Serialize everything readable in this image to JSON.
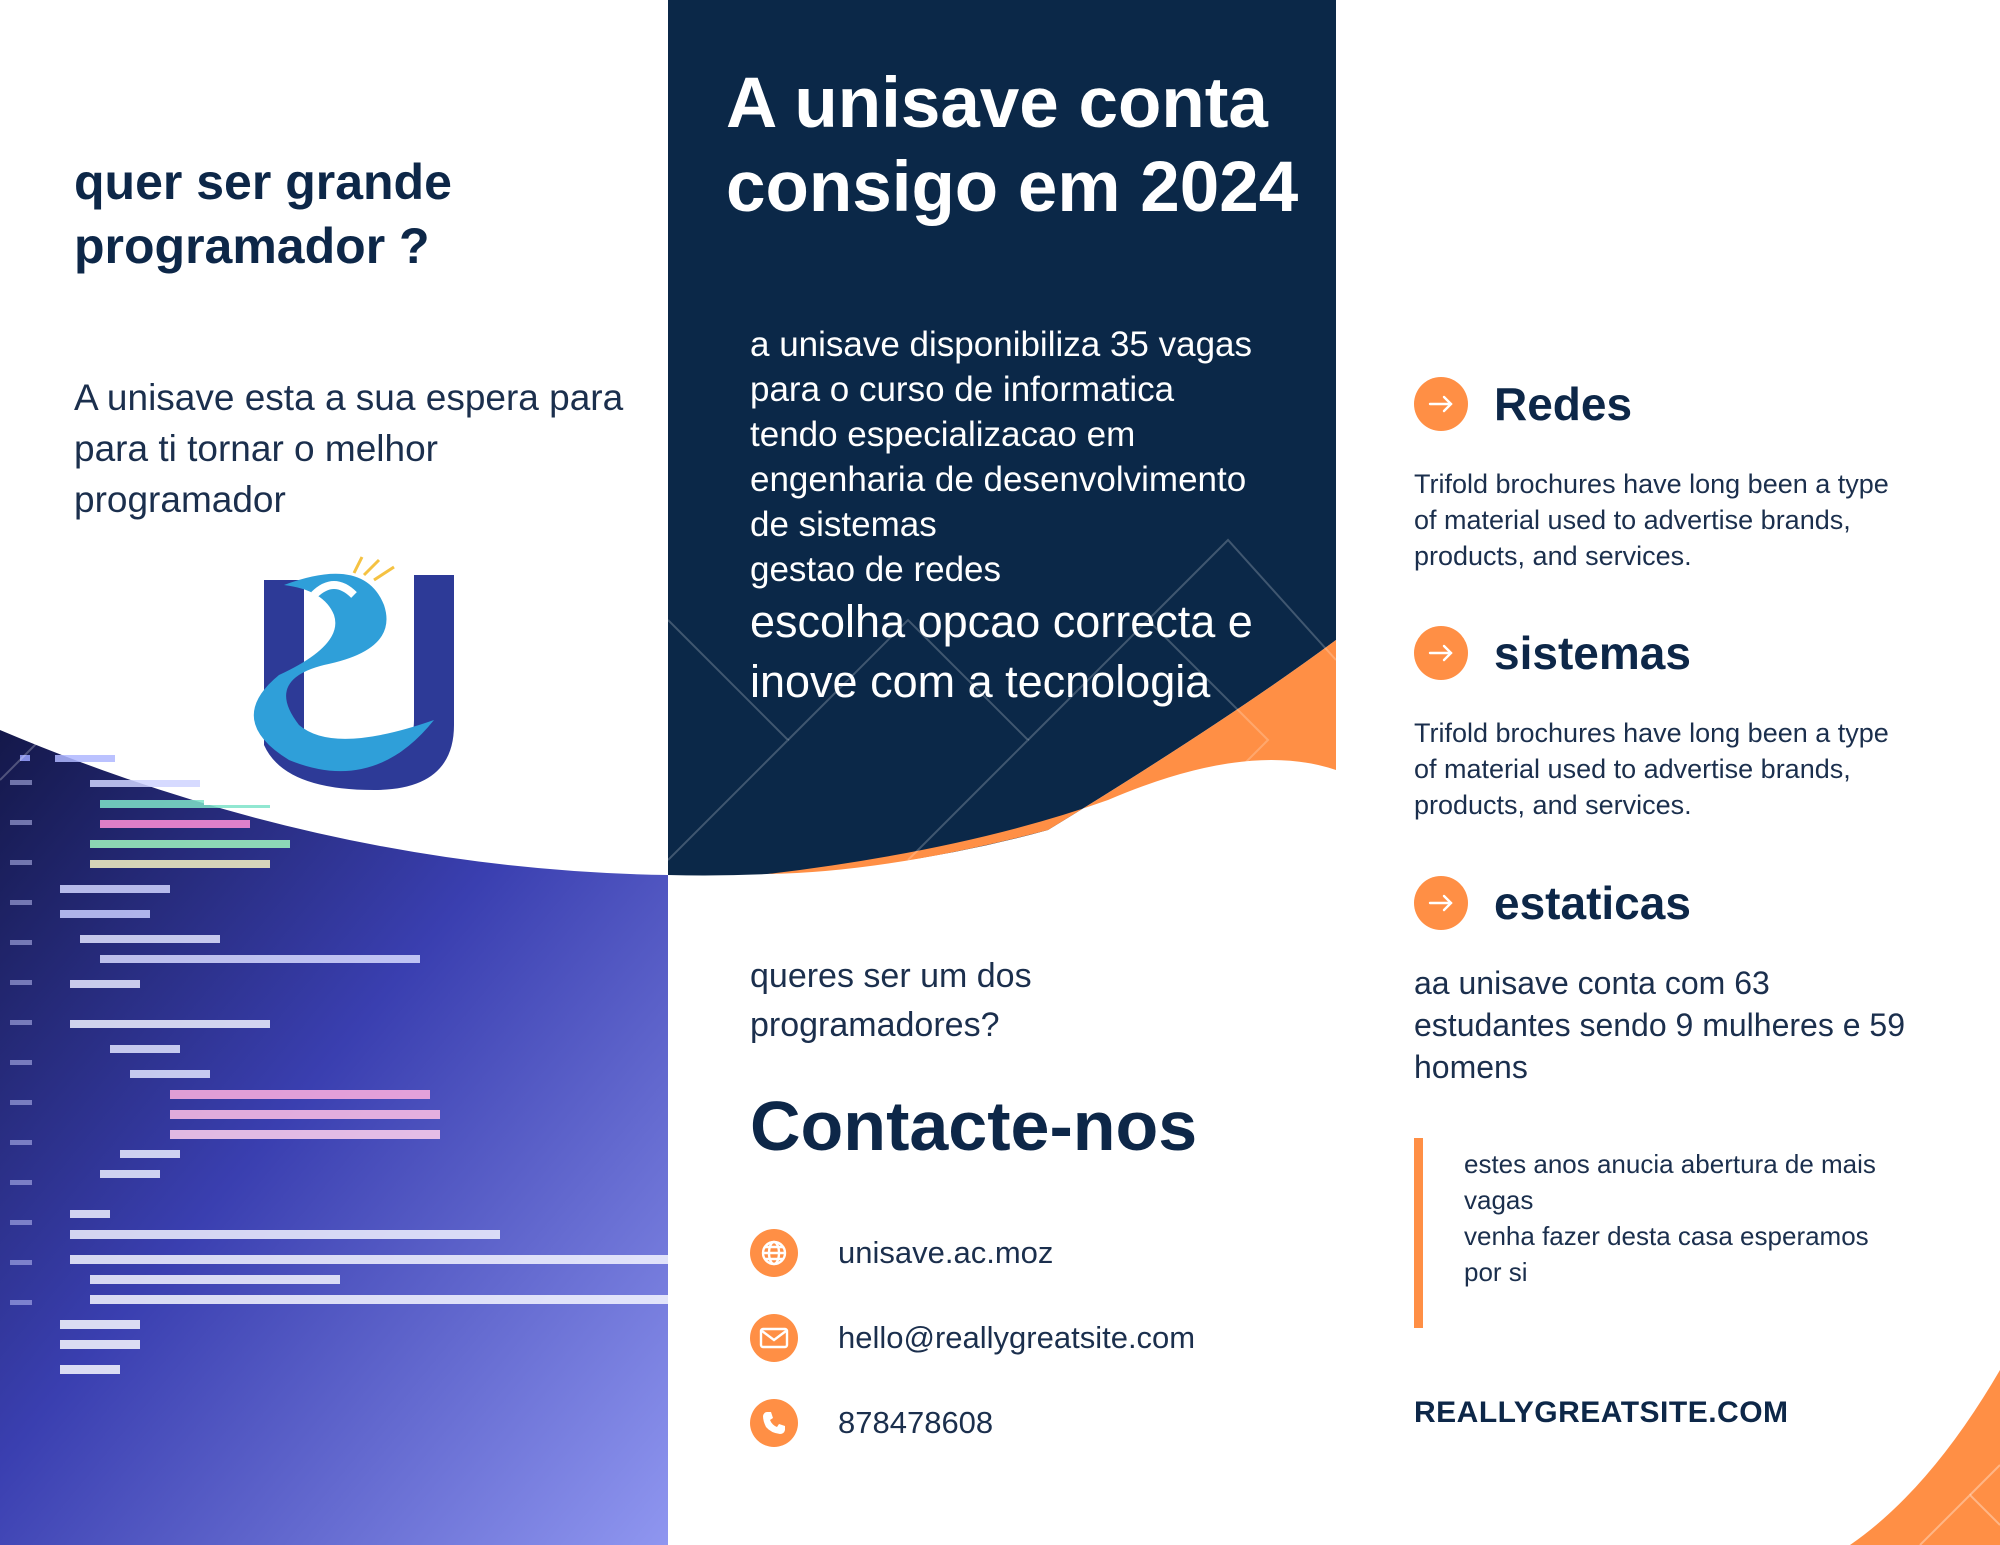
{
  "left_panel": {
    "headline": "quer ser grande programador ?",
    "body": "A unisave  esta a sua espera para para ti tornar o melhor programador",
    "logo_icon": "unisave-logo-icon",
    "photo_icon": "code-screen-photo"
  },
  "middle_panel": {
    "headline": "A unisave conta consigo em 2024",
    "body_lines": [
      "a unisave disponibiliza 35 vagas",
      "para o curso de informatica",
      "tendo especializacao em",
      "engenharia de desenvolvimento",
      "de sistemas",
      "gestao de redes"
    ],
    "highlight_lines": [
      "escolha opcao correcta e",
      "inove com a tecnologia"
    ],
    "question_lines": [
      "queres ser um  dos",
      "programadores?"
    ],
    "contact_title": "Contacte-nos",
    "contacts": {
      "website": {
        "icon": "globe-icon",
        "text": "unisave.ac.moz"
      },
      "email": {
        "icon": "mail-icon",
        "text": "hello@reallygreatsite.com"
      },
      "phone": {
        "icon": "phone-icon",
        "text": "878478608"
      }
    }
  },
  "right_panel": {
    "features": [
      {
        "title": "Redes",
        "icon": "arrow-right-icon",
        "text_lines": [
          "Trifold brochures have long been a type",
          "of material used to advertise brands,",
          "products, and services."
        ]
      },
      {
        "title": "sistemas",
        "icon": "arrow-right-icon",
        "text_lines": [
          "Trifold brochures have long been a type",
          "of material used to advertise brands,",
          "products, and services."
        ]
      },
      {
        "title": "estaticas",
        "icon": "arrow-right-icon",
        "text_lines": [
          "aa unisave conta com 63",
          "estudantes  sendo 9 mulheres e 59",
          "homens"
        ]
      }
    ],
    "quote_lines": [
      "estes anos anucia abertura de mais",
      "vagas",
      "venha fazer desta casa esperamos",
      "por si"
    ],
    "site_url": "REALLYGREATSITE.COM"
  },
  "colors": {
    "navy": "#0b2848",
    "orange": "#ff8f45",
    "text_dark": "#0d2748",
    "logo_blue": "#2d3a97",
    "logo_cyan": "#2f9fd9"
  }
}
